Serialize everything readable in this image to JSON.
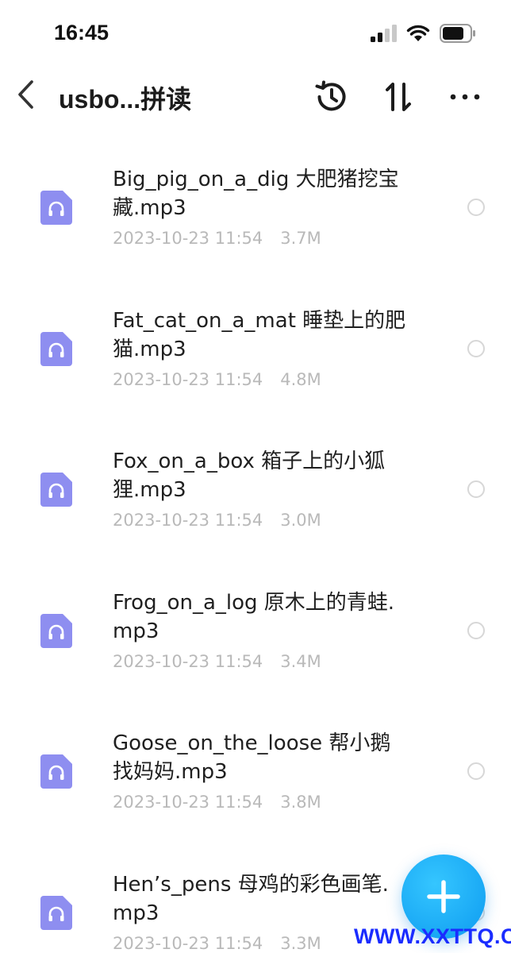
{
  "status_bar": {
    "time": "16:45"
  },
  "nav": {
    "title": "usbo...拼读",
    "icons": [
      "back-icon",
      "history-icon",
      "sort-icon",
      "more-icon"
    ]
  },
  "files": [
    {
      "name": "Big_pig_on_a_dig 大肥猪挖宝藏.mp3",
      "date": "2023-10-23 11:54",
      "size": "3.7M"
    },
    {
      "name": "Fat_cat_on_a_mat 睡垫上的肥猫.mp3",
      "date": "2023-10-23 11:54",
      "size": "4.8M"
    },
    {
      "name": "Fox_on_a_box  箱子上的小狐狸.mp3",
      "date": "2023-10-23 11:54",
      "size": "3.0M"
    },
    {
      "name": "Frog_on_a_log 原木上的青蛙.mp3",
      "date": "2023-10-23 11:54",
      "size": "3.4M"
    },
    {
      "name": "Goose_on_the_loose 帮小鹅找妈妈.mp3",
      "date": "2023-10-23 11:54",
      "size": "3.8M"
    },
    {
      "name": "Hen’s_pens 母鸡的彩色画笔.mp3",
      "date": "2023-10-23 11:54",
      "size": "3.3M"
    }
  ],
  "watermark": "WWW.XXTTQ.COM",
  "colors": {
    "file_icon": "#8e8ef0",
    "fab": "#19aaf5",
    "meta_text": "#b9b9b9",
    "watermark": "#1a2cff"
  }
}
